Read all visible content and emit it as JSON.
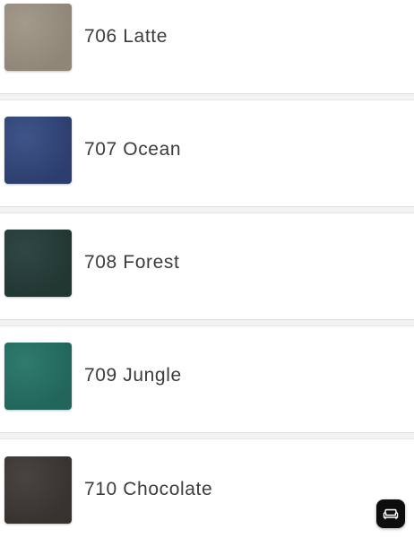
{
  "swatches": [
    {
      "label": "706 Latte",
      "color": "#a39a8c",
      "color_dark": "#8f8677"
    },
    {
      "label": "707 Ocean",
      "color": "#3f5489",
      "color_dark": "#2c3e6d"
    },
    {
      "label": "708 Forest",
      "color": "#2f4743",
      "color_dark": "#223632"
    },
    {
      "label": "709 Jungle",
      "color": "#2f7b6d",
      "color_dark": "#22655a"
    },
    {
      "label": "710 Chocolate",
      "color": "#4a4440",
      "color_dark": "#37322f"
    }
  ],
  "floating_button": {
    "icon": "sofa-icon",
    "bg": "#0d0d0d"
  }
}
